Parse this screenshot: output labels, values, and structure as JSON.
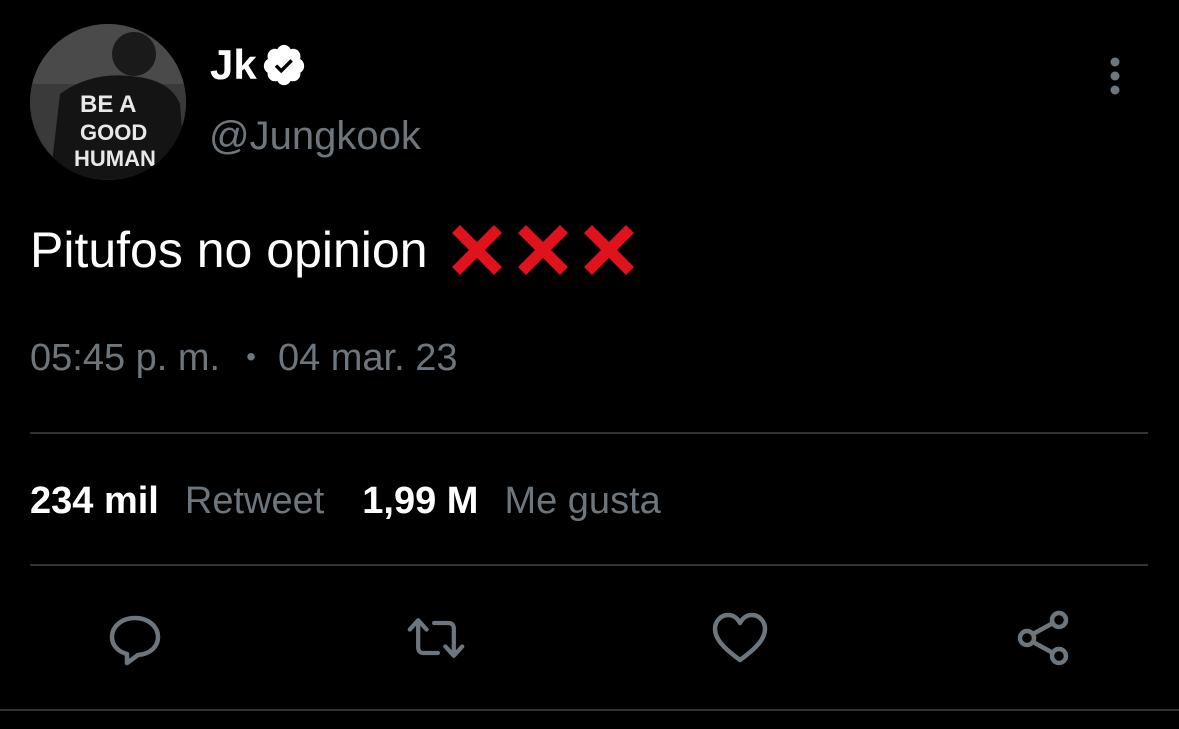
{
  "author": {
    "display_name": "Jk",
    "handle": "@Jungkook",
    "verified_icon": "verified-badge-icon",
    "avatar_shirt_text": [
      "BE A",
      "GOOD",
      "HUMAN"
    ]
  },
  "tweet": {
    "text": "Pitufos no opinion",
    "emoji": [
      "❌",
      "❌",
      "❌"
    ],
    "time": "05:45 p. m.",
    "separator": "•",
    "date": "04 mar. 23"
  },
  "stats": {
    "retweets_count": "234 mil",
    "retweets_label": "Retweet",
    "likes_count": "1,99 M",
    "likes_label": "Me gusta"
  },
  "actions": [
    "reply-icon",
    "retweet-icon",
    "like-icon",
    "share-icon"
  ],
  "colors": {
    "background": "#000000",
    "text": "#ffffff",
    "secondary": "#6e767d",
    "divider": "#2f3336",
    "emoji_red": "#e0121b"
  }
}
